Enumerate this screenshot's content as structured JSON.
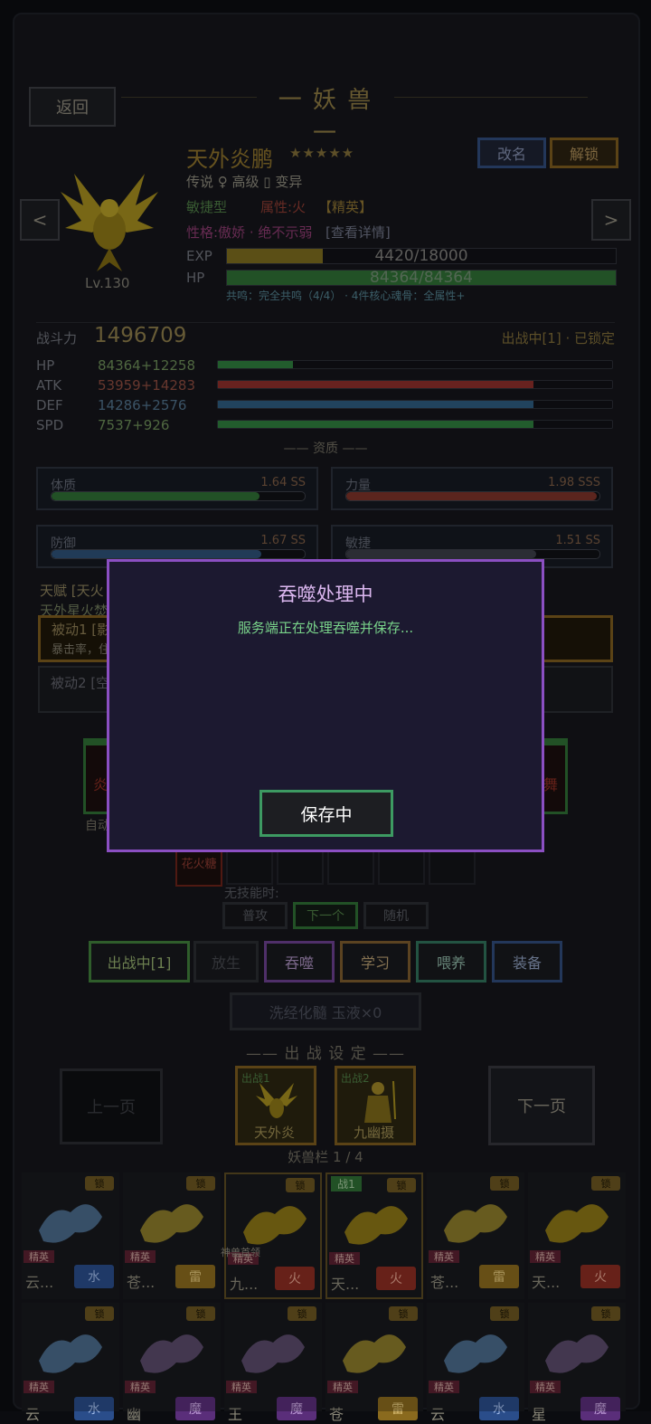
{
  "header": {
    "back_label": "返回",
    "title": "一 妖 兽 一"
  },
  "pet": {
    "name": "天外炎鹏",
    "stars": "★★★★★",
    "meta": "传说 ♀ 高级 ▯ 变异",
    "type": "敏捷型",
    "attribute": "属性:火",
    "rank": "【精英】",
    "personality": "性格:傲娇 · 绝不示弱",
    "detail_link": "[查看详情]",
    "level": "Lv.130",
    "rename_label": "改名",
    "unlock_label": "解锁",
    "prev_label": "<",
    "next_label": ">",
    "exp_label": "EXP",
    "exp_text": "4420/18000",
    "exp_fraction": 0.2456,
    "hp_label": "HP",
    "hp_text": "84364/84364",
    "hp_fraction": 1.0,
    "resonance": "共鸣：完全共鸣（4/4） · 4件核心魂骨：全属性+"
  },
  "combat": {
    "power_label": "战斗力",
    "power_value": "1496709",
    "status": "出战中[1] · 已锁定",
    "stats": [
      {
        "label": "HP",
        "value": "84364+12258",
        "fraction": 0.19,
        "color": "#2e7b3c"
      },
      {
        "label": "ATK",
        "value": "53959+14283",
        "fraction": 0.8,
        "color": "#8a2e2a"
      },
      {
        "label": "DEF",
        "value": "14286+2576",
        "fraction": 0.8,
        "color": "#2c5a7c"
      },
      {
        "label": "SPD",
        "value": "7537+926",
        "fraction": 0.8,
        "color": "#2e7b3c"
      }
    ]
  },
  "aptitude": {
    "section_title": "—— 资质 ——",
    "items": [
      {
        "name": "体质",
        "value": "1.64 SS",
        "fraction": 0.82,
        "color": "#2e6d33"
      },
      {
        "name": "力量",
        "value": "1.98 SSS",
        "fraction": 0.99,
        "color": "#7a3228"
      },
      {
        "name": "防御",
        "value": "1.67 SS",
        "fraction": 0.83,
        "color": "#2c4f74"
      },
      {
        "name": "敏捷",
        "value": "1.51 SS",
        "fraction": 0.75,
        "color": "#3a3d46"
      }
    ]
  },
  "talent": {
    "title": "天赋 [天火",
    "subtitle": "天外星火焚",
    "passive1": "被动1 [影",
    "passive1_desc": "暴击率，住",
    "passive2": "被动2 [空"
  },
  "skills": {
    "left_card": "炎",
    "left_caption": "自动",
    "right_card": "舞",
    "slot_skill": "花火糖",
    "no_skill_label": "无技能时:",
    "modes": [
      "普攻",
      "下一个",
      "随机"
    ]
  },
  "actions": [
    {
      "label": "出战中[1]",
      "color": "#3f7d3a",
      "text": "#8fa86a"
    },
    {
      "label": "放生",
      "color": "#2a2c30",
      "text": "#45474c"
    },
    {
      "label": "吞噬",
      "color": "#6a3f8c",
      "text": "#a58bb8"
    },
    {
      "label": "学习",
      "color": "#7a5a2c",
      "text": "#b39a6e"
    },
    {
      "label": "喂养",
      "color": "#2f6f58",
      "text": "#8ab1a0"
    },
    {
      "label": "装备",
      "color": "#2f4a78",
      "text": "#8a9ab8"
    }
  ],
  "wash_label": "洗经化髓  玉液×0",
  "deploy": {
    "section_title": "—— 出 战 设 定 ——",
    "prev_page": "上一页",
    "next_page": "下一页",
    "slot1_tag": "出战1",
    "slot1_name": "天外炎",
    "slot2_tag": "出战2",
    "slot2_name": "九幽摄",
    "page_info": "妖兽栏 1 / 4"
  },
  "roster": [
    {
      "name": "云...",
      "elem": "水",
      "elem_bg": "#2a4d8a",
      "elem_fg": "#9cb7e6",
      "lock": "锁",
      "elite": "精英"
    },
    {
      "name": "苍...",
      "elem": "雷",
      "elem_bg": "#8a6a1e",
      "elem_fg": "#e0c47a",
      "lock": "锁",
      "elite": "精英"
    },
    {
      "name": "九...",
      "elem": "火",
      "elem_bg": "#8a2c22",
      "elem_fg": "#e0a08c",
      "lock": "锁",
      "elite": "精英",
      "badge": "神兽首领",
      "selected": true
    },
    {
      "name": "天...",
      "elem": "火",
      "elem_bg": "#8a2c22",
      "elem_fg": "#e0a08c",
      "lock": "锁",
      "elite": "精英",
      "battle": "战1",
      "selected": true
    },
    {
      "name": "苍...",
      "elem": "雷",
      "elem_bg": "#8a6a1e",
      "elem_fg": "#e0c47a",
      "lock": "锁",
      "elite": "精英"
    },
    {
      "name": "天...",
      "elem": "火",
      "elem_bg": "#8a2c22",
      "elem_fg": "#e0a08c",
      "lock": "锁",
      "elite": "精英"
    },
    {
      "name": "云",
      "elem": "水",
      "elem_bg": "#2a4d8a",
      "elem_fg": "#9cb7e6",
      "lock": "锁",
      "elite": "精英"
    },
    {
      "name": "幽",
      "elem": "魔",
      "elem_bg": "#5a2e7a",
      "elem_fg": "#c3a0dc",
      "lock": "锁",
      "elite": "精英"
    },
    {
      "name": "王",
      "elem": "魔",
      "elem_bg": "#5a2e7a",
      "elem_fg": "#c3a0dc",
      "lock": "锁",
      "elite": "精英"
    },
    {
      "name": "苍",
      "elem": "雷",
      "elem_bg": "#8a6a1e",
      "elem_fg": "#e0c47a",
      "lock": "锁",
      "elite": "精英"
    },
    {
      "name": "云",
      "elem": "水",
      "elem_bg": "#2a4d8a",
      "elem_fg": "#9cb7e6",
      "lock": "锁",
      "elite": "精英"
    },
    {
      "name": "星",
      "elem": "魔",
      "elem_bg": "#5a2e7a",
      "elem_fg": "#c3a0dc",
      "lock": "锁",
      "elite": "精英"
    }
  ],
  "modal": {
    "title": "吞噬处理中",
    "message": "服务端正在处理吞噬并保存...",
    "button": "保存中"
  }
}
